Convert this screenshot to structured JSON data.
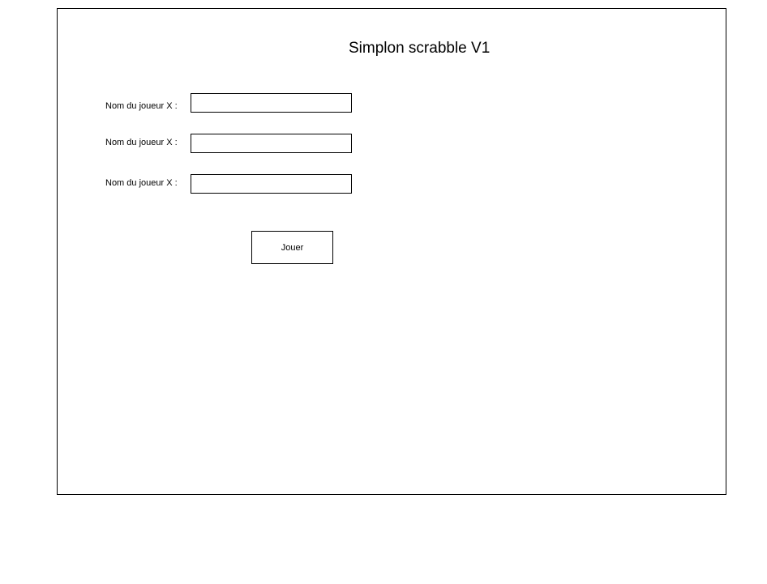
{
  "form": {
    "title": "Simplon scrabble V1",
    "players": [
      {
        "label": "Nom du joueur X :",
        "value": "",
        "placeholder": ""
      },
      {
        "label": "Nom du joueur X :",
        "value": "",
        "placeholder": ""
      },
      {
        "label": "Nom du joueur X :",
        "value": "",
        "placeholder": ""
      }
    ],
    "play_label": "Jouer"
  },
  "colors": {
    "border": "#000000",
    "background": "#ffffff",
    "text": "#000000"
  }
}
